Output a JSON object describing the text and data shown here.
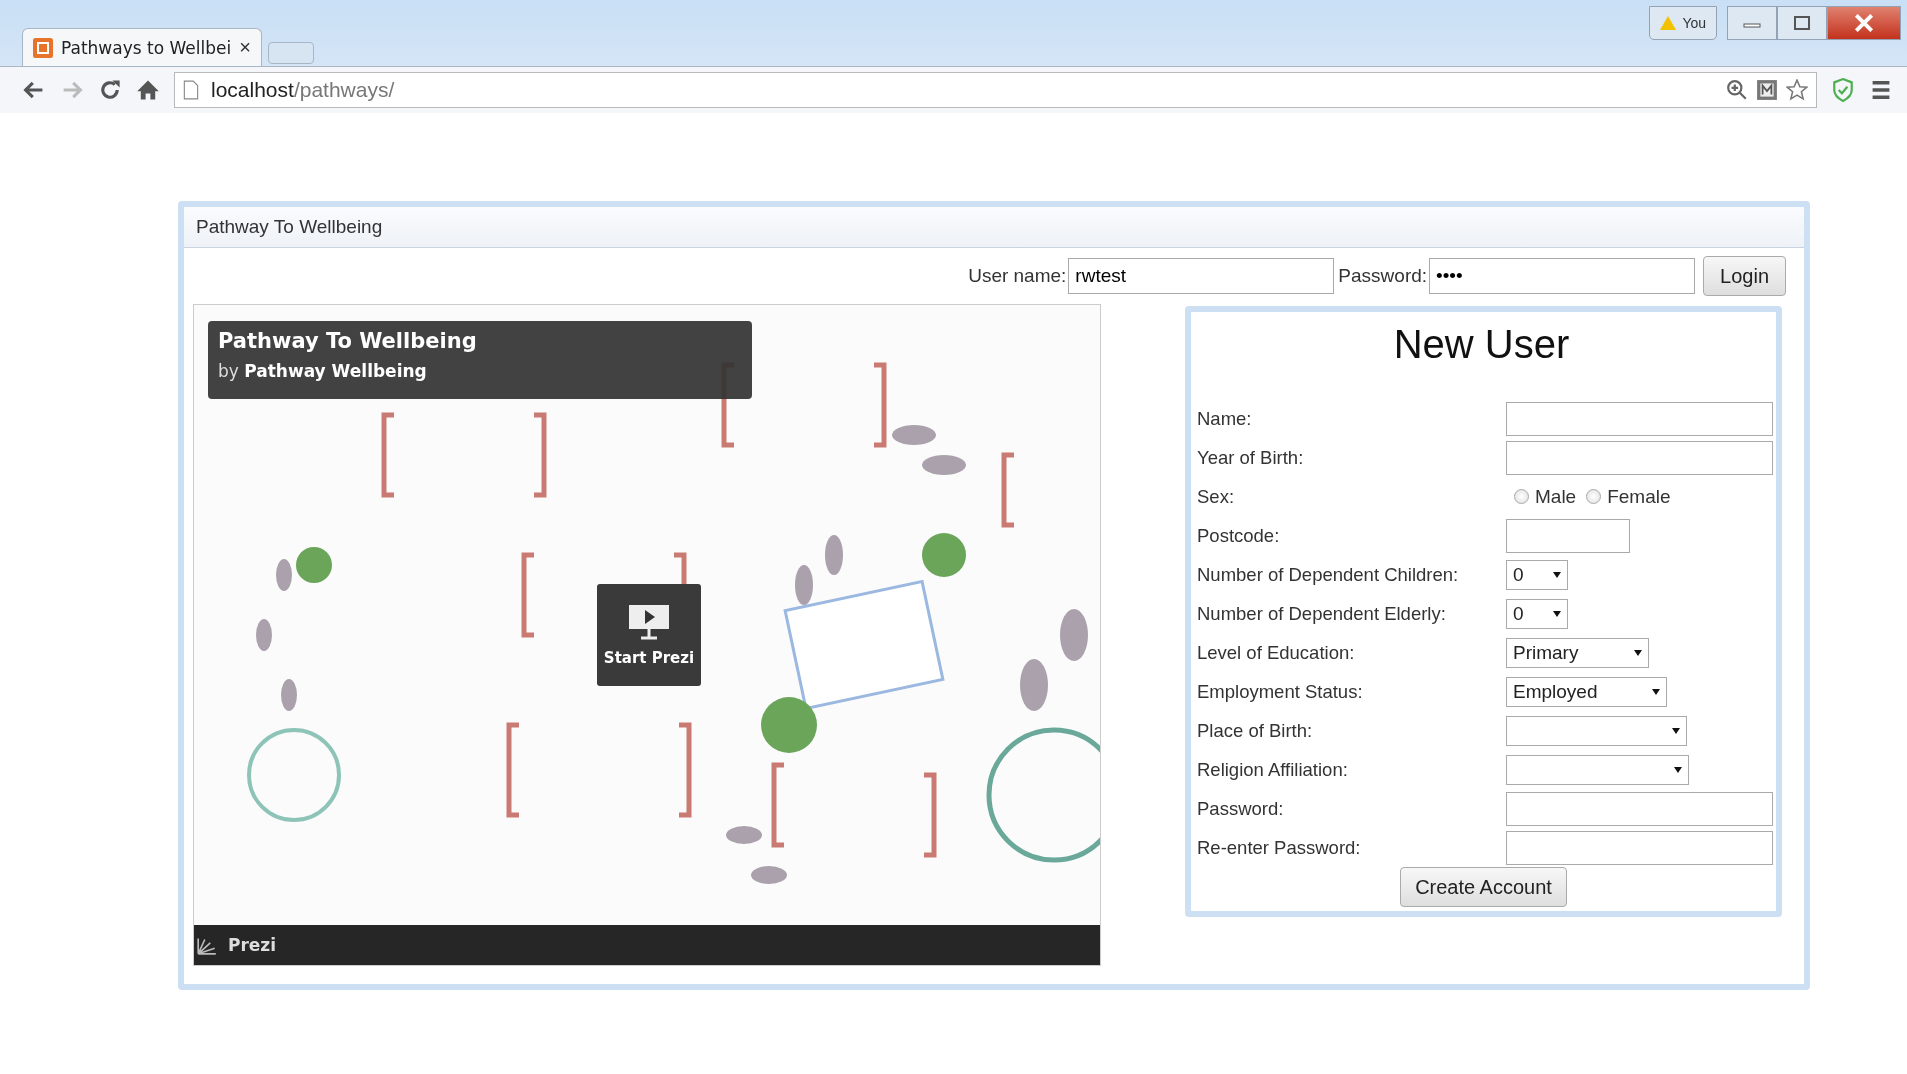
{
  "browser": {
    "tab_title": "Pathways to Wellbei",
    "tab_close": "×",
    "url_host": "localhost",
    "url_path": "/pathways/",
    "profile_label": "You"
  },
  "panel": {
    "title": "Pathway To Wellbeing"
  },
  "login": {
    "username_label": "User name:",
    "username_value": "rwtest",
    "password_label": "Password:",
    "password_value": "••••",
    "button": "Login"
  },
  "prezi": {
    "title": "Pathway To Wellbeing",
    "by": "by",
    "author": "Pathway Wellbeing",
    "start_label": "Start Prezi",
    "brand": "Prezi"
  },
  "new_user": {
    "title": "New User",
    "fields": [
      {
        "label": "Name:",
        "kind": "text"
      },
      {
        "label": "Year of Birth:",
        "kind": "text"
      },
      {
        "label": "Sex:",
        "kind": "radio",
        "options": [
          {
            "label": "Male",
            "selected": false
          },
          {
            "label": "Female",
            "selected": false
          }
        ]
      },
      {
        "label": "Postcode:",
        "kind": "short"
      },
      {
        "label": "Number of Dependent Children:",
        "kind": "select",
        "value": "0"
      },
      {
        "label": "Number of Dependent Elderly:",
        "kind": "select",
        "value": "0"
      },
      {
        "label": "Level of Education:",
        "kind": "select",
        "value": "Primary"
      },
      {
        "label": "Employment Status:",
        "kind": "select",
        "value": "Employed"
      },
      {
        "label": "Place of Birth:",
        "kind": "select"
      },
      {
        "label": "Religion Affiliation:",
        "kind": "select"
      },
      {
        "label": "Password:",
        "kind": "text"
      },
      {
        "label": "Re-enter Password:",
        "kind": "text"
      }
    ],
    "button": "Create Account"
  }
}
